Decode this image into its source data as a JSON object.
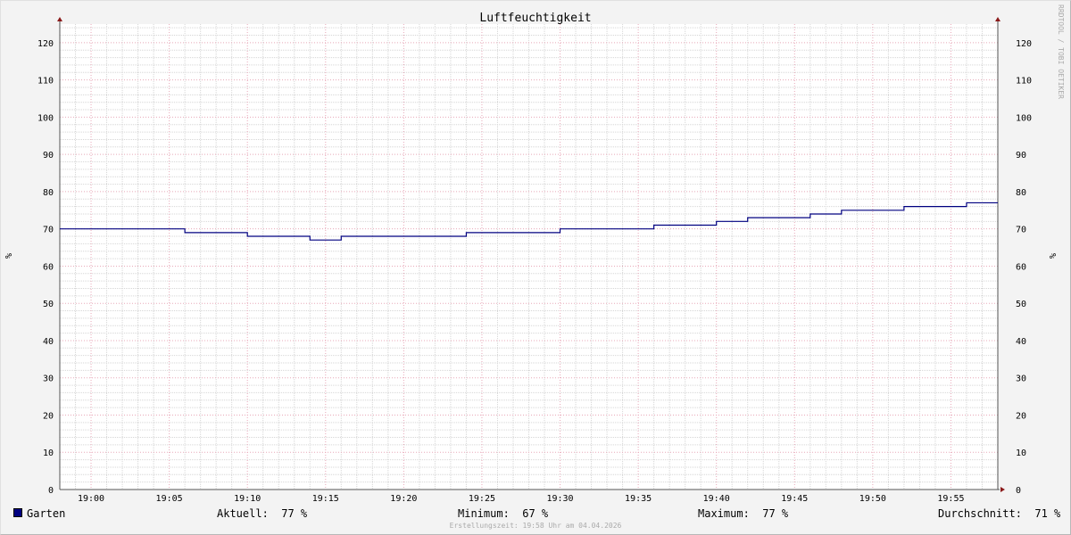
{
  "chart_data": {
    "type": "line",
    "title": "Luftfeuchtigkeit",
    "ylabel": "%",
    "ylim": [
      0,
      125
    ],
    "y_ticks": [
      0,
      10,
      20,
      30,
      40,
      50,
      60,
      70,
      80,
      90,
      100,
      110,
      120
    ],
    "xlim": [
      "18:58",
      "19:58"
    ],
    "x_ticks": [
      "19:00",
      "19:05",
      "19:10",
      "19:15",
      "19:20",
      "19:25",
      "19:30",
      "19:35",
      "19:40",
      "19:45",
      "19:50",
      "19:55"
    ],
    "grid": true,
    "legend_position": "bottom",
    "series": [
      {
        "name": "Garten",
        "color": "#000080",
        "step": true,
        "points": [
          {
            "x": "18:58",
            "y": 70
          },
          {
            "x": "19:06",
            "y": 69
          },
          {
            "x": "19:10",
            "y": 68
          },
          {
            "x": "19:14",
            "y": 67
          },
          {
            "x": "19:16",
            "y": 68
          },
          {
            "x": "19:24",
            "y": 69
          },
          {
            "x": "19:30",
            "y": 70
          },
          {
            "x": "19:36",
            "y": 71
          },
          {
            "x": "19:40",
            "y": 72
          },
          {
            "x": "19:42",
            "y": 73
          },
          {
            "x": "19:46",
            "y": 74
          },
          {
            "x": "19:48",
            "y": 75
          },
          {
            "x": "19:52",
            "y": 76
          },
          {
            "x": "19:56",
            "y": 77
          },
          {
            "x": "19:58",
            "y": 77
          }
        ]
      }
    ]
  },
  "legend": {
    "series_name": "Garten",
    "aktuell": "Aktuell:  77 %",
    "minimum": "Minimum:  67 %",
    "maximum": "Maximum:  77 %",
    "durchschnitt": "Durchschnitt:  71 %"
  },
  "footer": "Erstellungszeit: 19:58 Uhr am 04.04.2026",
  "watermark": "RRDTOOL / TOBI OETIKER",
  "colors": {
    "background": "#f3f3f3",
    "canvas": "#ffffff",
    "major_grid": "#e8a8b8",
    "minor_grid": "#d6d6d6",
    "series": "#000080",
    "axis_arrow": "#8b1a1a"
  }
}
